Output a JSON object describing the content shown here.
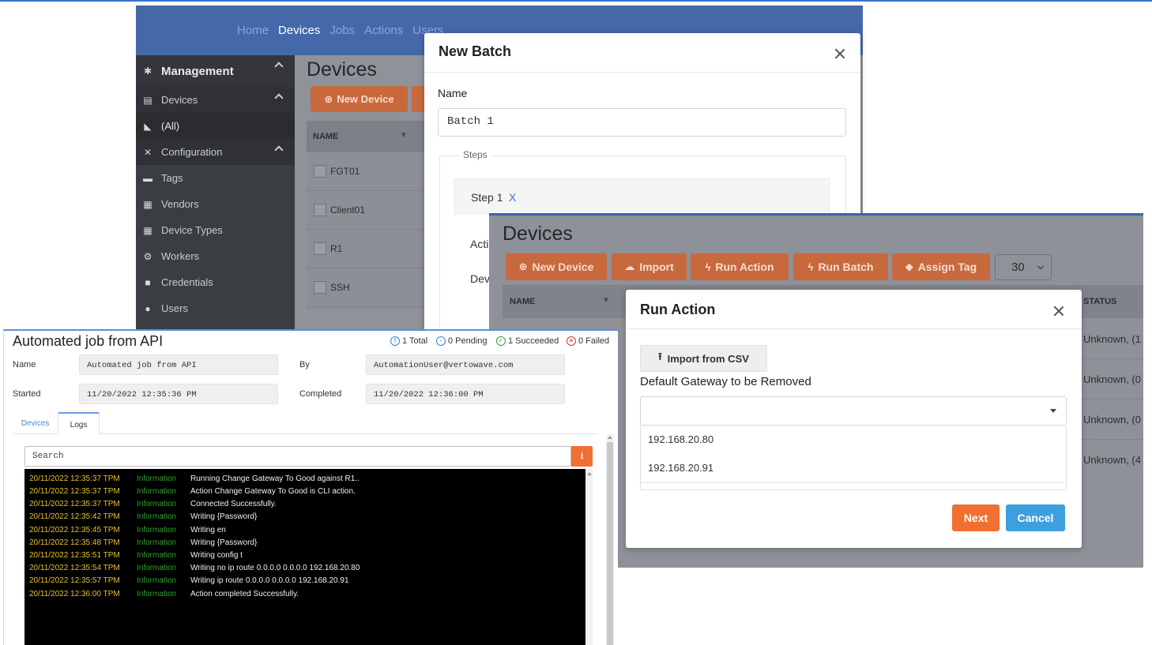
{
  "management_app": {
    "top_nav": [
      "Home",
      "Devices",
      "Jobs",
      "Actions",
      "Users"
    ],
    "active_nav": "Devices",
    "sidebar": {
      "header": "Management",
      "items": [
        {
          "label": "Devices",
          "icon": "server-icon"
        },
        {
          "label": "(All)",
          "icon": "tag-icon"
        },
        {
          "label": "Configuration",
          "icon": "tools-icon"
        },
        {
          "label": "Tags",
          "icon": "folder-icon"
        },
        {
          "label": "Vendors",
          "icon": "store-icon"
        },
        {
          "label": "Device Types",
          "icon": "grid-icon"
        },
        {
          "label": "Workers",
          "icon": "cogs-icon"
        },
        {
          "label": "Credentials",
          "icon": "lock-icon"
        },
        {
          "label": "Users",
          "icon": "users-icon"
        }
      ]
    },
    "page_title": "Devices",
    "new_device_label": "New Device",
    "table": {
      "column_name": "NAME",
      "rows": [
        "FGT01",
        "Client01",
        "R1",
        "SSH"
      ]
    }
  },
  "new_batch_dialog": {
    "title": "New Batch",
    "name_label": "Name",
    "name_value": "Batch 1",
    "steps_label": "Steps",
    "step_title": "Step 1",
    "step_remove": "X",
    "action_label_partial": "Acti",
    "device_label_partial": "Dev"
  },
  "devices_window": {
    "title": "Devices",
    "toolbar": {
      "new_device": "New Device",
      "import": "Import",
      "run_action": "Run Action",
      "run_batch": "Run Batch",
      "assign_tag": "Assign Tag",
      "page_size": "30"
    },
    "table": {
      "column_name": "NAME",
      "column_status": "STATUS",
      "status_values": [
        "Unknown, (1",
        "Unknown, (0",
        "Unknown, (0",
        "Unknown, (4"
      ]
    }
  },
  "run_action_dialog": {
    "title": "Run Action",
    "import_csv_label": "Import from CSV",
    "field_label": "Default Gateway to be Removed",
    "select_value": "",
    "options": [
      "192.168.20.80",
      "192.168.20.91"
    ],
    "next_label": "Next",
    "cancel_label": "Cancel",
    "colors": {
      "next": "#f26f32",
      "cancel": "#3e9fde"
    }
  },
  "job_window": {
    "title": "Automated job from API",
    "stats": {
      "total": "1 Total",
      "pending": "0 Pending",
      "succeeded": "1 Succeeded",
      "failed": "0 Failed"
    },
    "fields": {
      "name_label": "Name",
      "name_value": "Automated job from API",
      "by_label": "By",
      "by_value": "AutomationUser@vertowave.com",
      "started_label": "Started",
      "started_value": "11/20/2022 12:35:36 PM",
      "completed_label": "Completed",
      "completed_value": "11/20/2022 12:36:00 PM"
    },
    "tabs": [
      "Devices",
      "Logs"
    ],
    "active_tab": "Logs",
    "search_placeholder": "Search",
    "logs": [
      {
        "ts": "20/11/2022 12:35:37 TPM",
        "level": "Information",
        "msg": "Running Change Gateway To Good against R1.."
      },
      {
        "ts": "20/11/2022 12:35:37 TPM",
        "level": "Information",
        "msg": "Action Change Gateway To Good is CLI action."
      },
      {
        "ts": "20/11/2022 12:35:37 TPM",
        "level": "Information",
        "msg": "Connected Successfully."
      },
      {
        "ts": "20/11/2022 12:35:42 TPM",
        "level": "Information",
        "msg": "Writing {Password}"
      },
      {
        "ts": "20/11/2022 12:35:45 TPM",
        "level": "Information",
        "msg": "Writing en"
      },
      {
        "ts": "20/11/2022 12:35:48 TPM",
        "level": "Information",
        "msg": "Writing {Password}"
      },
      {
        "ts": "20/11/2022 12:35:51 TPM",
        "level": "Information",
        "msg": "Writing config t"
      },
      {
        "ts": "20/11/2022 12:35:54 TPM",
        "level": "Information",
        "msg": "Writing no ip route 0.0.0.0 0.0.0.0 192.168.20.80"
      },
      {
        "ts": "20/11/2022 12:35:57 TPM",
        "level": "Information",
        "msg": "Writing ip route 0.0.0.0 0.0.0.0 192.168.20.91"
      },
      {
        "ts": "20/11/2022 12:36:00 TPM",
        "level": "Information",
        "msg": "Action completed Successfully."
      }
    ]
  }
}
